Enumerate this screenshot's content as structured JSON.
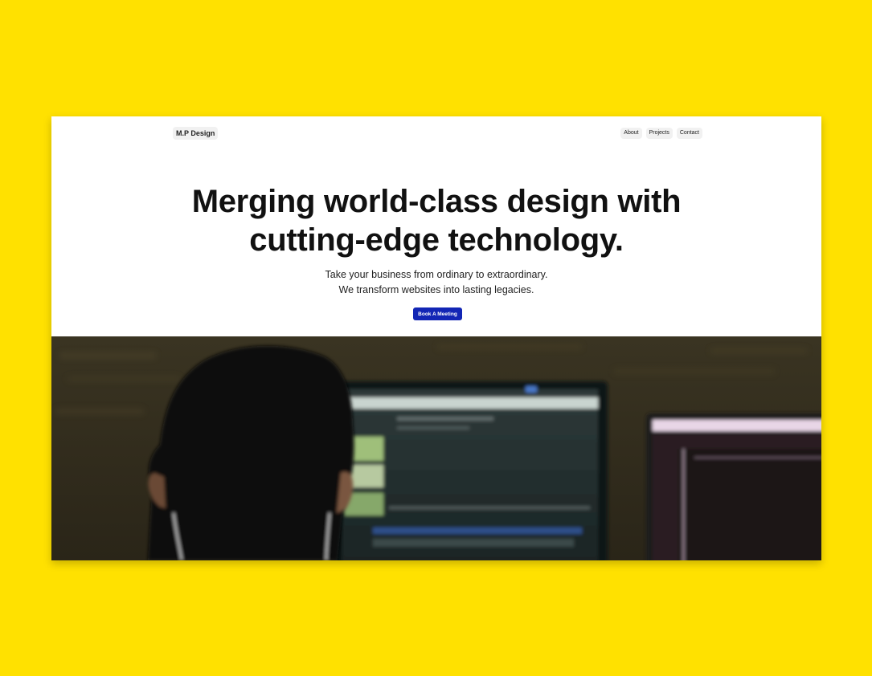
{
  "nav": {
    "logo": "M.P Design",
    "menu": [
      "About",
      "Projects",
      "Contact"
    ]
  },
  "hero": {
    "title_line1": "Merging world-class design with",
    "title_line2": "cutting-edge technology.",
    "subtitle_line1": "Take your business from ordinary to extraordinary.",
    "subtitle_line2": "We transform websites into lasting legacies.",
    "cta_label": "Book A Meeting"
  },
  "colors": {
    "page_background": "#FFE100",
    "cta": "#1226B5"
  },
  "image": {
    "subject": "person-at-computer-monitors-photo"
  }
}
